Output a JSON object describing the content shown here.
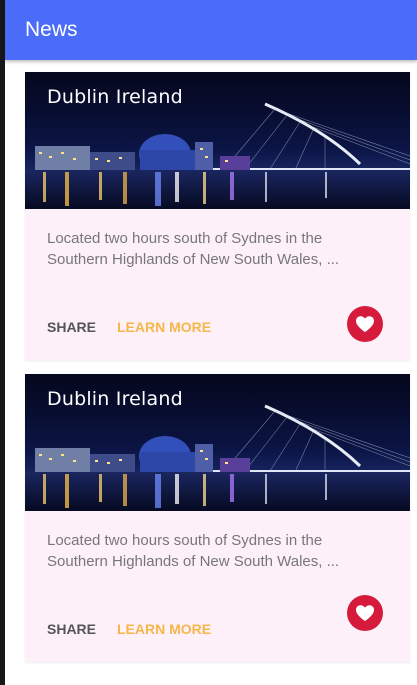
{
  "app_bar": {
    "title": "News"
  },
  "cards": [
    {
      "image_title": "Dublin Ireland",
      "description": "Located two hours south of Sydnes in the Southern Highlands of New South Wales, ...",
      "share_label": "SHARE",
      "learn_more_label": "LEARN MORE",
      "favorite_icon": "heart-icon"
    },
    {
      "image_title": "Dublin Ireland",
      "description": "Located two hours south of Sydnes in the Southern Highlands of New South Wales, ...",
      "share_label": "SHARE",
      "learn_more_label": "LEARN MORE",
      "favorite_icon": "heart-icon"
    }
  ],
  "colors": {
    "app_bar": "#4b6cf8",
    "card_background": "#fdf0f8",
    "learn_more": "#f5b74a",
    "favorite": "#d61a3c"
  }
}
